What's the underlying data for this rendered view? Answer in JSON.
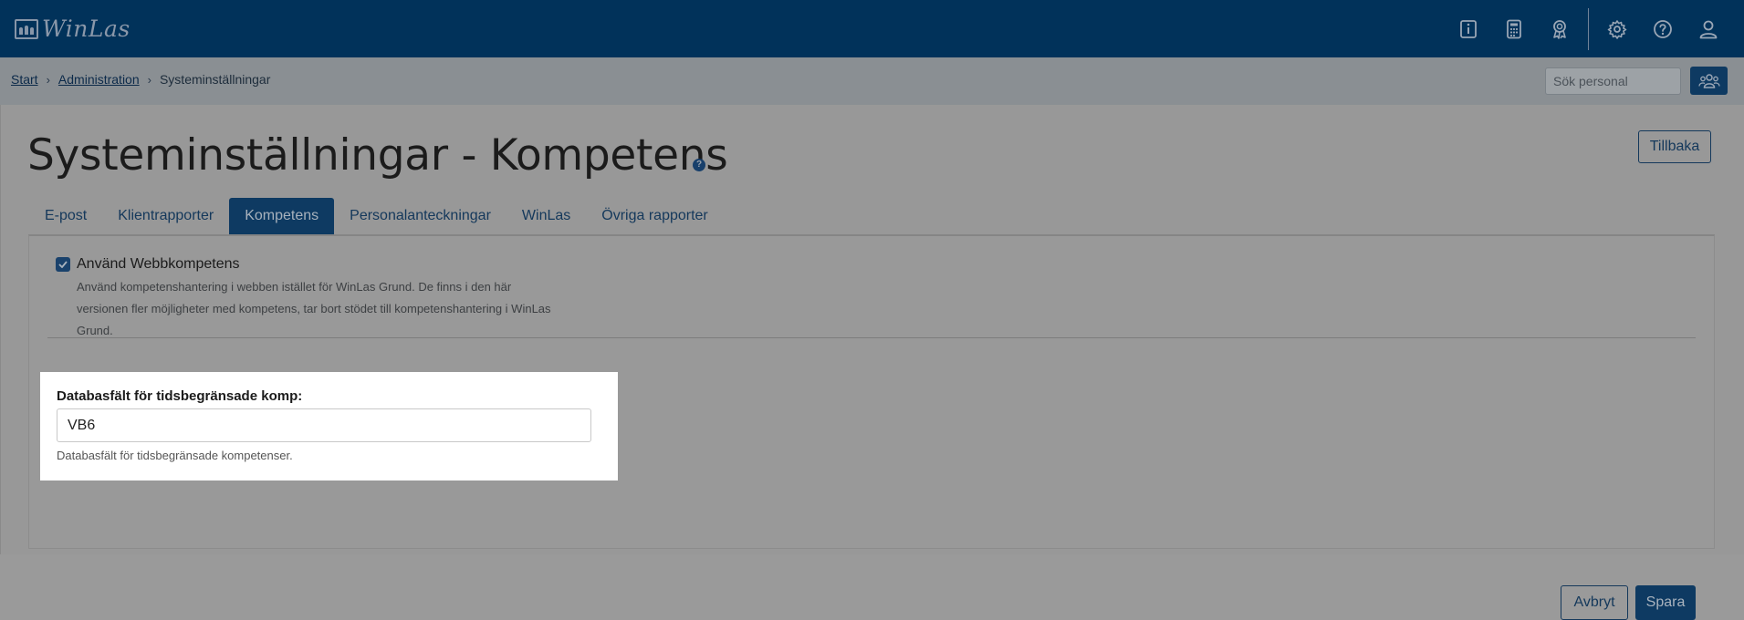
{
  "app": {
    "name": "WinLas"
  },
  "top_icons": [
    "info-icon",
    "calculator-icon",
    "award-icon",
    "gear-icon",
    "help-icon",
    "user-icon"
  ],
  "breadcrumb": {
    "items": [
      {
        "label": "Start",
        "link": true
      },
      {
        "label": "Administration",
        "link": true
      },
      {
        "label": "Systeminställningar",
        "link": false
      }
    ],
    "separator": "›"
  },
  "search": {
    "placeholder": "Sök personal",
    "value": ""
  },
  "page": {
    "title": "Systeminställningar - Kompetens",
    "help_glyph": "?",
    "back_label": "Tillbaka"
  },
  "tabs": [
    {
      "label": "E-post",
      "active": false
    },
    {
      "label": "Klientrapporter",
      "active": false
    },
    {
      "label": "Kompetens",
      "active": true
    },
    {
      "label": "Personalanteckningar",
      "active": false
    },
    {
      "label": "WinLas",
      "active": false
    },
    {
      "label": "Övriga rapporter",
      "active": false
    }
  ],
  "settings": {
    "use_web_competence": {
      "checked": true,
      "label": "Använd Webbkompetens",
      "help_lines": [
        "Använd kompetenshantering i webben istället för WinLas Grund. De finns i den här",
        "versionen fler möjligheter med kompetens, tar bort stödet till kompetenshantering i WinLas",
        "Grund."
      ]
    },
    "db_field": {
      "label": "Databasfält för tidsbegränsade komp:",
      "value": "VB6",
      "help": "Databasfält för tidsbegränsade kompetenser."
    }
  },
  "actions": {
    "cancel_label": "Avbryt",
    "save_label": "Spara"
  },
  "colors": {
    "navy": "#01325a",
    "accent": "#0e3a62",
    "overlay": "#989898"
  }
}
